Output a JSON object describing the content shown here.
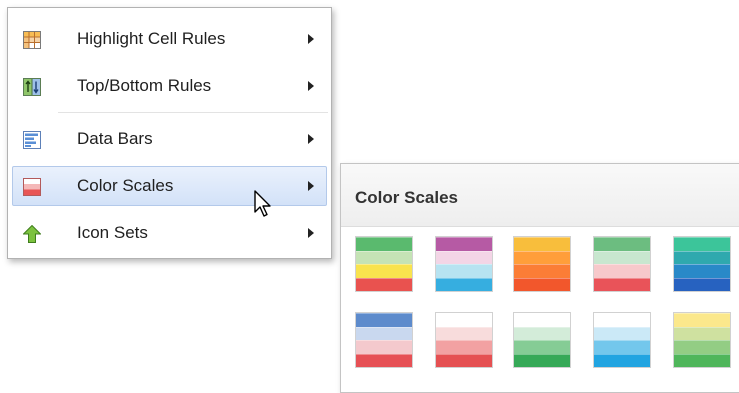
{
  "menu": {
    "items": [
      {
        "label": "Highlight Cell Rules",
        "icon": "highlight-cell-rules-icon",
        "active": false
      },
      {
        "label": "Top/Bottom Rules",
        "icon": "top-bottom-rules-icon",
        "active": false
      },
      {
        "label": "Data Bars",
        "icon": "data-bars-icon",
        "active": false
      },
      {
        "label": "Color Scales",
        "icon": "color-scales-icon",
        "active": true
      },
      {
        "label": "Icon Sets",
        "icon": "icon-sets-icon",
        "active": false
      }
    ]
  },
  "submenu": {
    "title": "Color Scales",
    "swatches": [
      [
        "#5aba6e",
        "#c5e3b5",
        "#f9e34e",
        "#e9524f"
      ],
      [
        "#b65aa4",
        "#f3d5e6",
        "#b7e3f1",
        "#36aee0"
      ],
      [
        "#f8be3c",
        "#ff9e3a",
        "#fb7d36",
        "#f2572c"
      ],
      [
        "#6cbd80",
        "#c8e7cf",
        "#f7c9cb",
        "#e95359"
      ],
      [
        "#3cc59a",
        "#2fa9ae",
        "#2989c8",
        "#2762c0"
      ],
      [
        "#5d8bcc",
        "#c9d8ef",
        "#f4c9cd",
        "#e65055"
      ],
      [
        "#ffffff",
        "#f8dcdc",
        "#f2a1a2",
        "#e55052"
      ],
      [
        "#ffffff",
        "#d3ecd9",
        "#85cc95",
        "#36a957"
      ],
      [
        "#ffffff",
        "#cbe9f7",
        "#73c7ec",
        "#21a4e1"
      ],
      [
        "#fbe88c",
        "#cfe1a0",
        "#93cd84",
        "#4fb65b"
      ]
    ]
  }
}
